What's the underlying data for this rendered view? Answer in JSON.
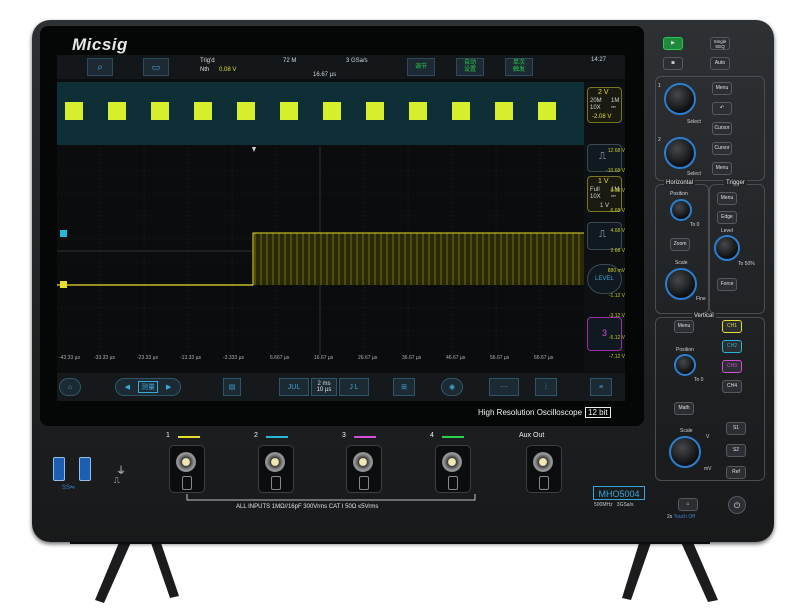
{
  "brand": "Micsig",
  "screen": {
    "top": {
      "trigger_mode": "Trig'd",
      "trigger_source": "Nth",
      "trigger_value": "0.08 V",
      "memory": "72 M",
      "sample_rate": "3 GSa/s",
      "time_offset": "16.67 µs",
      "clock": "14:27",
      "btn_adjust": "调节",
      "btn_auto_set": "自动\n设置",
      "btn_single": "单次\n触发"
    },
    "ch_box": {
      "label": "2 V",
      "line1_a": "20M",
      "line1_b": "1M",
      "line2_a": "10X",
      "line2_b": "⎓",
      "line3": "-2.08 V"
    },
    "ch_box2": {
      "label": "1 V",
      "line1_a": "Full",
      "line1_b": "1M",
      "line2_a": "10X",
      "line2_b": "⎓",
      "line3": "1 V"
    },
    "right_ticks": [
      "12.68 V",
      "-10.68 V",
      "8.68 V",
      "6.68 V",
      "4.68 V",
      "2.68 V",
      "880 mV",
      "-1.12 V",
      "-3.12 V",
      "-5.12 V",
      "-7.12 V"
    ],
    "x_ticks": [
      "-43.33 µs",
      "-33.33 µs",
      "-23.33 µs",
      "-13.33 µs",
      "-3.333 µs",
      "6.667 µs",
      "16.67 µs",
      "26.67 µs",
      "36.67 µs",
      "46.67 µs",
      "56.67 µs",
      "66.67 µs"
    ],
    "right_buttons": {
      "r1": "3",
      "r2": "4"
    },
    "bottom": {
      "timebase_a": "2 ms",
      "timebase_b": "10 µs",
      "measure_label": "测量"
    }
  },
  "label_hr": "High Resolution Oscilloscope",
  "label_bits": "12 bit",
  "front": {
    "ch_nums": [
      "1",
      "2",
      "3",
      "4"
    ],
    "aux_out": "Aux Out",
    "spec": "ALL INPUTS 1MΩ//16pF 300Vrms CAT I    50Ω  ≤5Vrms",
    "model": "MHO5004",
    "model_bw": "500MHz",
    "model_sr": "3GSa/s",
    "ch_colors": [
      "#e6dd2c",
      "#26b6d6",
      "#d34fd6",
      "#2bd14c"
    ]
  },
  "controls": {
    "single_seq": "Single\nSEQ",
    "auto": "Auto",
    "menu": "Menu",
    "cursor": "Cursor",
    "cursor2": "Cursor",
    "menu2": "Menu",
    "select": "Select",
    "horizontal": "Horizontal",
    "trigger": "Trigger",
    "position": "Position",
    "to0": "To 0",
    "zoom": "Zoom",
    "scale": "Scale",
    "fine": "Fine",
    "edge": "Edge",
    "level": "Level",
    "to50": "To 50%",
    "force": "Force",
    "vertical": "Vertical",
    "menu_v": "Menu",
    "ch1": "CH1",
    "ch2": "CH2",
    "ch3": "CH3",
    "ch4": "CH4",
    "position_v": "Position",
    "to0_v": "To 0",
    "math": "Math",
    "scale_v": "Scale",
    "v": "V",
    "mv": "mV",
    "s1": "S1",
    "s2": "S2",
    "ref": "Ref",
    "touch_off": "Touch Off",
    "two_s": "2s"
  }
}
